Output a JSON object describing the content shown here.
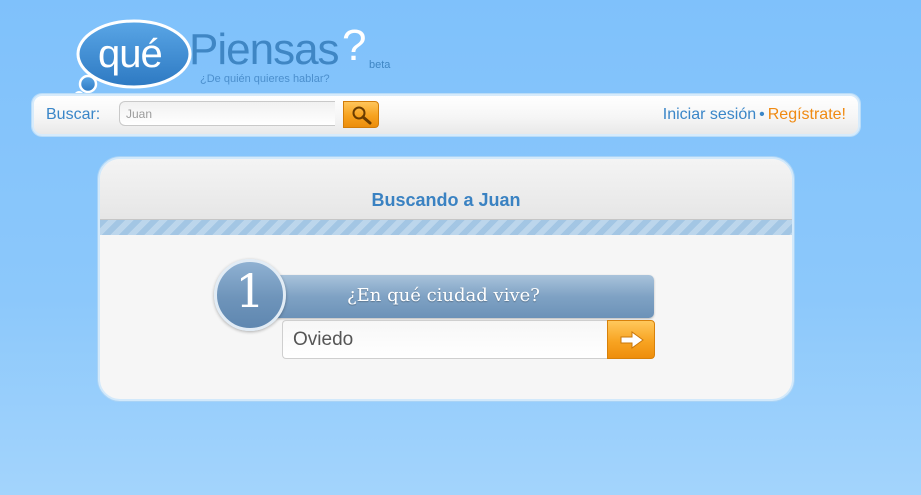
{
  "logo": {
    "que": "qué",
    "piensas": "Piensas",
    "question_mark": "?",
    "beta": "beta",
    "tagline": "¿De quién quieres hablar?"
  },
  "search": {
    "label": "Buscar:",
    "value": "Juan",
    "button_icon": "magnifier-icon"
  },
  "auth": {
    "login": "Iniciar sesión",
    "separator": "•",
    "register": "Regístrate!"
  },
  "panel": {
    "title": "Buscando a Juan"
  },
  "step": {
    "number": "1",
    "question": "¿En qué ciudad vive?",
    "answer_value": "Oviedo",
    "submit_icon": "arrow-right-icon"
  },
  "colors": {
    "background": "#7fc1fb",
    "brand_blue": "#3a86c8",
    "accent_orange": "#f08a12",
    "step_blue": "#7fa2c4"
  }
}
